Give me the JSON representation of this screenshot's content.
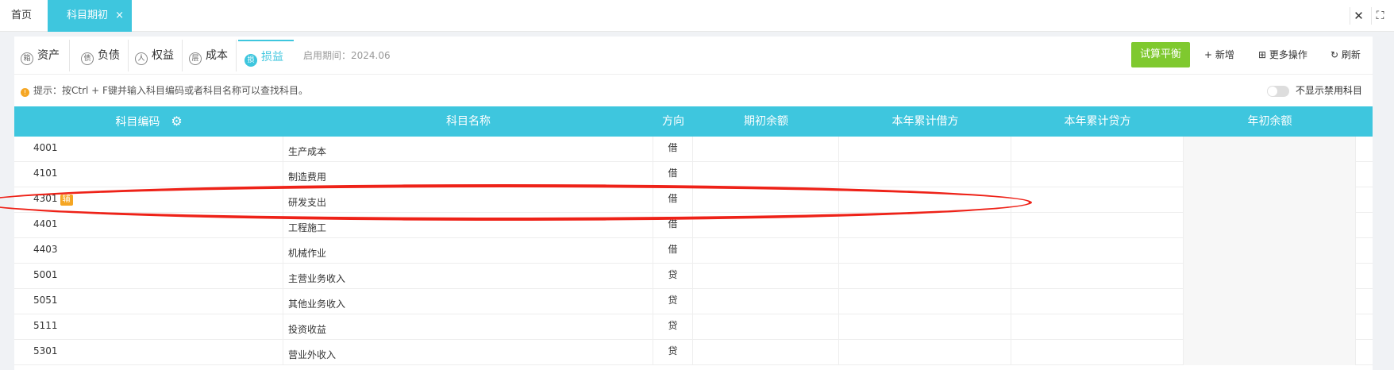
{
  "topbar": {
    "home_tab": "首页",
    "active_tab": "科目期初",
    "tab_close": "×",
    "close_glyph": "✕",
    "fullscreen_glyph": "⛶"
  },
  "category_tabs": [
    {
      "label": "资产",
      "icon": "箱"
    },
    {
      "label": "负债",
      "icon": "债"
    },
    {
      "label": "权益",
      "icon": "人"
    },
    {
      "label": "成本",
      "icon": "层"
    },
    {
      "label": "损益",
      "icon": "损"
    }
  ],
  "period_text": "启用期间：2024.06",
  "toolbar": {
    "trial_balance": "试算平衡",
    "add": "+ 新增",
    "more": "⊞ 更多操作",
    "refresh": "↻ 刷新"
  },
  "hint": {
    "text": "提示：按Ctrl + F键并输入科目编码或者科目名称可以查找科目。",
    "warn_icon": "!",
    "toggle_label": "不显示禁用科目"
  },
  "columns": {
    "code": "科目编码",
    "name": "科目名称",
    "direction": "方向",
    "opening_balance": "期初余额",
    "year_debit": "本年累计借方",
    "year_credit": "本年累计贷方",
    "year_begin_balance": "年初余额",
    "gear_glyph": "⚙"
  },
  "rows": [
    {
      "code": "4001",
      "name": "生产成本",
      "direction": "借"
    },
    {
      "code": "4101",
      "name": "制造费用",
      "direction": "借"
    },
    {
      "code": "4301",
      "name": "研发支出",
      "direction": "借",
      "badge": "辅"
    },
    {
      "code": "4401",
      "name": "工程施工",
      "direction": "借"
    },
    {
      "code": "4403",
      "name": "机械作业",
      "direction": "借"
    },
    {
      "code": "5001",
      "name": "主营业务收入",
      "direction": "贷"
    },
    {
      "code": "5051",
      "name": "其他业务收入",
      "direction": "贷"
    },
    {
      "code": "5111",
      "name": "投资收益",
      "direction": "贷"
    },
    {
      "code": "5301",
      "name": "营业外收入",
      "direction": "贷"
    }
  ],
  "colors": {
    "accent": "#3ec6de",
    "trial_button": "#7fc92f",
    "highlight": "#ee2218",
    "badge": "#f5a623"
  }
}
